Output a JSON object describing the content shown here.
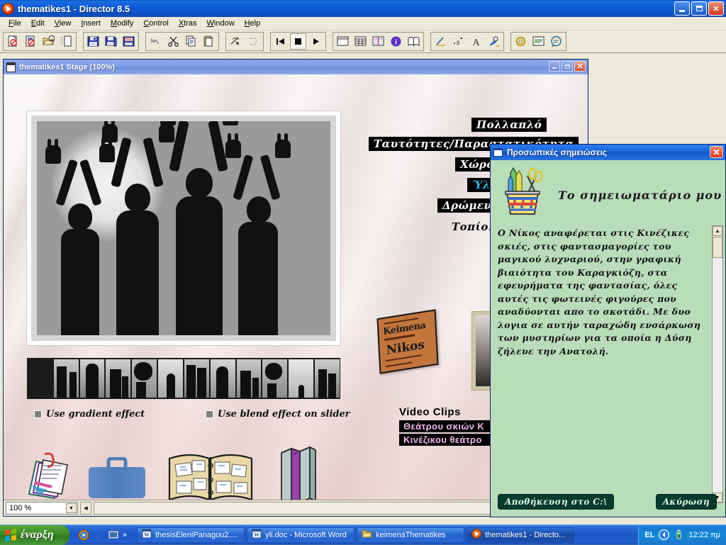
{
  "app": {
    "title": "thematikes1 - Director 8.5",
    "icon": "director-icon",
    "window_buttons": [
      "minimize",
      "maximize",
      "close"
    ],
    "menus": [
      {
        "label": "File",
        "mnemonic": "F"
      },
      {
        "label": "Edit",
        "mnemonic": "E"
      },
      {
        "label": "View",
        "mnemonic": "V"
      },
      {
        "label": "Insert",
        "mnemonic": "I"
      },
      {
        "label": "Modify",
        "mnemonic": "M"
      },
      {
        "label": "Control",
        "mnemonic": "C"
      },
      {
        "label": "Xtras",
        "mnemonic": "X"
      },
      {
        "label": "Window",
        "mnemonic": "W"
      },
      {
        "label": "Help",
        "mnemonic": "H"
      }
    ],
    "toolbar_icons": [
      "new-movie-icon",
      "new-cast-icon",
      "open-icon",
      "import-icon",
      "save-icon",
      "save-all-icon",
      "save-as-shockwave-icon",
      "undo-icon",
      "cut-icon",
      "copy-icon",
      "paste-icon",
      "find-icon",
      "exchange-cast-members-icon",
      "rewind-icon",
      "stop-icon",
      "play-icon",
      "stage-window-icon",
      "cast-window-icon",
      "score-window-icon",
      "property-inspector-icon",
      "library-palette-icon",
      "pencil-tool-icon",
      "script-icon",
      "text-window-icon",
      "paint-window-icon",
      "behavior-inspector-icon",
      "message-window-icon",
      "debugger-icon"
    ]
  },
  "stage": {
    "title": "thematikes1 Stage (100%)",
    "zoom_value": "100 %",
    "window_buttons": [
      "minimize",
      "maximize",
      "close"
    ],
    "labels": [
      {
        "name": "label-pollaplo",
        "text": "Πολλαπλό",
        "color": "#ffffff"
      },
      {
        "name": "label-taftotites",
        "text": "Ταυτότητες/Παραστατικότητα",
        "color": "#ffffff"
      },
      {
        "name": "label-choros",
        "text": "Χώρος/",
        "color": "#ffffff"
      },
      {
        "name": "label-yli",
        "text": "Ύλη/Εξ",
        "color": "#2bb6f2"
      },
      {
        "name": "label-dromeno",
        "text": "Δρώμενο/Α",
        "color": "#ffffff"
      },
      {
        "name": "label-topio",
        "text": "Τοπίο...",
        "color": "#000000"
      }
    ],
    "checkboxes": [
      {
        "name": "use-gradient-effect",
        "label": "Use gradient effect",
        "checked": false
      },
      {
        "name": "use-blend-effect-on-slider",
        "label": "Use blend effect on slider",
        "checked": false
      }
    ],
    "video_clips": {
      "title": "Video Clips",
      "items": [
        "Θεάτρου σκιών Κ",
        "Κινέζικου θεάτρο"
      ]
    },
    "scrap_note": {
      "line1": "Keimena",
      "line2": "Nikos"
    },
    "bottom_icons": [
      {
        "name": "notes-papers-icon"
      },
      {
        "name": "briefcase-icon"
      },
      {
        "name": "photo-album-icon"
      },
      {
        "name": "books-icon"
      }
    ]
  },
  "notes": {
    "title": "Προσωπικές σημειώσεις",
    "icon": "window-icon",
    "close_label": "✕",
    "heading": "Το σημειωματάριο μου",
    "cup_icon": "pencil-cup-icon",
    "body_text": "Ο Νίκος αναφέρεται στις Κινέζικες σκιές, στις φαντασμαγορίες του μαγικού λυχναριού, στην γραφική βιαιότητα του Καραγκιόζη, στα εφευρήματα της φαντασίας, όλες αυτές τις φωτεινές φιγούρες που αναδύονται απο το σκοτάδι. Με δυο λογια σε αυτήν ταραχώδη ενσάρκωση των μυστηρίων για τα οποία η Δύση ζήλευε την Ανατολή.",
    "buttons": {
      "save": "Αποθήκευση στο C:\\",
      "cancel": "Ακύρωση"
    },
    "scrollbar": {
      "up": "▲",
      "down": "▼"
    }
  },
  "taskbar": {
    "start_label": "έναρξη",
    "quicklaunch": [
      {
        "name": "media-player-icon"
      },
      {
        "name": "internet-explorer-icon"
      },
      {
        "name": "show-desktop-icon"
      }
    ],
    "quicklaunch_chevron": "»",
    "tasks": [
      {
        "name": "task-thesis-doc",
        "label": "thesisEleniPanagou2....",
        "icon": "word-icon",
        "active": false
      },
      {
        "name": "task-yli-doc",
        "label": "yli.doc - Microsoft Word",
        "icon": "word-icon",
        "active": false
      },
      {
        "name": "task-keimena-folder",
        "label": "keimenaThematikes",
        "icon": "folder-icon",
        "active": false
      },
      {
        "name": "task-director",
        "label": "thematikes1 - Directo...",
        "icon": "director-icon",
        "active": true
      }
    ],
    "tray": {
      "language": "EL",
      "icons": [
        {
          "name": "volume-icon"
        },
        {
          "name": "battery-icon"
        }
      ],
      "clock": "12:22 πμ"
    }
  }
}
